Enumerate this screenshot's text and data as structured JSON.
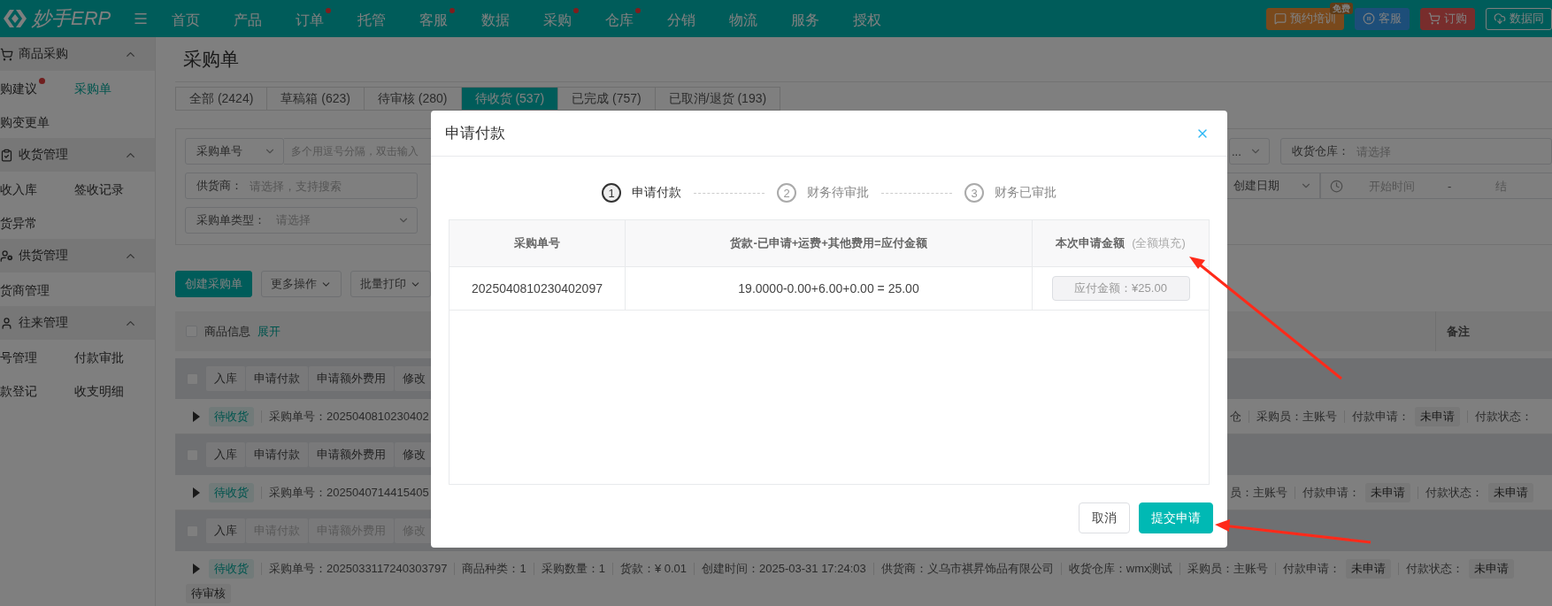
{
  "topbar": {
    "logo": "妙手ERP",
    "nav": [
      {
        "label": "首页",
        "dot": false
      },
      {
        "label": "产品",
        "dot": false
      },
      {
        "label": "订单",
        "dot": true
      },
      {
        "label": "托管",
        "dot": false
      },
      {
        "label": "客服",
        "dot": true
      },
      {
        "label": "数据",
        "dot": false
      },
      {
        "label": "采购",
        "dot": true
      },
      {
        "label": "仓库",
        "dot": true
      },
      {
        "label": "分销",
        "dot": false
      },
      {
        "label": "物流",
        "dot": false
      },
      {
        "label": "服务",
        "dot": false
      },
      {
        "label": "授权",
        "dot": false
      }
    ],
    "actions": [
      {
        "kind": "training",
        "label": "预约培训",
        "badge": "免费"
      },
      {
        "kind": "service",
        "label": "客服"
      },
      {
        "kind": "order",
        "label": "订购"
      },
      {
        "kind": "sync",
        "label": "数据同"
      }
    ]
  },
  "sidebar": [
    {
      "title": "商品采购",
      "expanded": true,
      "items": [
        {
          "label": "购建议",
          "dot": true,
          "selected": false
        },
        {
          "label": "采购单",
          "dot": false,
          "selected": true
        },
        {
          "label": "购变更单",
          "dot": false,
          "selected": false
        }
      ]
    },
    {
      "title": "收货管理",
      "expanded": true,
      "items": [
        {
          "label": "收入库",
          "dot": false,
          "selected": false
        },
        {
          "label": "签收记录",
          "dot": false,
          "selected": false
        },
        {
          "label": "货异常",
          "dot": false,
          "selected": false
        }
      ]
    },
    {
      "title": "供货管理",
      "expanded": true,
      "items": [
        {
          "label": "货商管理",
          "dot": false,
          "selected": false
        }
      ]
    },
    {
      "title": "往来管理",
      "expanded": true,
      "items": [
        {
          "label": "号管理",
          "dot": false,
          "selected": false
        },
        {
          "label": "付款审批",
          "dot": false,
          "selected": false
        },
        {
          "label": "款登记",
          "dot": false,
          "selected": false
        },
        {
          "label": "收支明细",
          "dot": false,
          "selected": false
        }
      ]
    }
  ],
  "page": {
    "title": "采购单",
    "tabs": [
      {
        "label": "全部 (2424)",
        "selected": false
      },
      {
        "label": "草稿箱 (623)",
        "selected": false
      },
      {
        "label": "待审核 (280)",
        "selected": false
      },
      {
        "label": "待收货 (537)",
        "selected": true
      },
      {
        "label": "已完成 (757)",
        "selected": false
      },
      {
        "label": "已取消/退货 (193)",
        "selected": false
      }
    ],
    "filters": {
      "order_field": {
        "label": "采购单号",
        "placeholder": "多个用逗号分隔，双击输入"
      },
      "right_select": {
        "value": "..."
      },
      "warehouse": {
        "label": "收货仓库：",
        "placeholder": "请选择"
      },
      "supplier": {
        "label": "供货商：",
        "placeholder": "请选择，支持搜索"
      },
      "date": {
        "type": "创建日期",
        "start_placeholder": "开始时间",
        "separator": "-",
        "end_placeholder": "结"
      },
      "order_type": {
        "label": "采购单类型：",
        "placeholder": "请选择"
      }
    },
    "toolbar": [
      {
        "kind": "primary",
        "label": "创建采购单"
      },
      {
        "kind": "dropdown",
        "label": "更多操作"
      },
      {
        "kind": "dropdown",
        "label": "批量打印"
      }
    ],
    "table": {
      "select_all": false,
      "label": "商品信息",
      "expand_link": "展开",
      "remark": "备注"
    },
    "orders": [
      {
        "checked": false,
        "actions": [
          {
            "label": "入库",
            "disabled": false
          },
          {
            "label": "申请付款",
            "disabled": false
          },
          {
            "label": "申请额外费用",
            "disabled": false
          },
          {
            "label": "修改",
            "disabled": false
          }
        ],
        "status": "待收货",
        "left": [
          {
            "kind": "text",
            "text": "采购单号：2025040810230402"
          }
        ],
        "right": [
          {
            "kind": "text",
            "text": "仓"
          },
          {
            "kind": "text",
            "text": "采购员：主账号"
          },
          {
            "kind": "text",
            "text": "付款申请："
          },
          {
            "kind": "tag",
            "text": "未申请"
          },
          {
            "kind": "text",
            "text": "付款状态："
          }
        ]
      },
      {
        "checked": false,
        "actions": [
          {
            "label": "入库",
            "disabled": false
          },
          {
            "label": "申请付款",
            "disabled": false
          },
          {
            "label": "申请额外费用",
            "disabled": false
          },
          {
            "label": "修改",
            "disabled": false
          }
        ],
        "status": "待收货",
        "left": [
          {
            "kind": "text",
            "text": "采购单号：2025040714415405"
          }
        ],
        "right": [
          {
            "kind": "text",
            "text": "员：主账号"
          },
          {
            "kind": "text",
            "text": "付款申请："
          },
          {
            "kind": "tag",
            "text": "未申请"
          },
          {
            "kind": "text",
            "text": "付款状态："
          },
          {
            "kind": "tag",
            "text": "未申请"
          }
        ]
      },
      {
        "checked": false,
        "actions": [
          {
            "label": "入库",
            "disabled": false
          },
          {
            "label": "申请付款",
            "disabled": true
          },
          {
            "label": "申请额外费用",
            "disabled": true
          },
          {
            "label": "修改",
            "disabled": true
          }
        ],
        "status": "待收货",
        "left": [
          {
            "kind": "text",
            "text": "采购单号：2025033117240303797"
          },
          {
            "kind": "text",
            "text": "商品种类：1"
          },
          {
            "kind": "text",
            "text": "采购数量：1"
          },
          {
            "kind": "text",
            "text": "货款：¥ 0.01"
          },
          {
            "kind": "text",
            "text": "创建时间：2025-03-31 17:24:03"
          },
          {
            "kind": "text",
            "text": "供货商：义乌市祺昇饰品有限公司"
          },
          {
            "kind": "text",
            "text": "收货仓库：wmx测试"
          },
          {
            "kind": "text",
            "text": "采购员：主账号"
          },
          {
            "kind": "text",
            "text": "付款申请："
          },
          {
            "kind": "tag",
            "text": "未申请"
          },
          {
            "kind": "text",
            "text": "付款状态："
          },
          {
            "kind": "tag",
            "text": "未申请"
          }
        ],
        "sub_tag": "待审核"
      }
    ]
  },
  "dialog": {
    "title": "申请付款",
    "steps": [
      {
        "number": "1",
        "label": "申请付款",
        "active": true
      },
      {
        "number": "2",
        "label": "财务待审批",
        "active": false
      },
      {
        "number": "3",
        "label": "财务已审批",
        "active": false
      }
    ],
    "table": {
      "columns": [
        {
          "label": "采购单号"
        },
        {
          "label": "货款-已申请+运费+其他费用=应付金额"
        },
        {
          "label": "本次申请金额",
          "hint": "(全额填充)"
        }
      ],
      "rows": [
        {
          "order_no": "2025040810230402097",
          "formula": "19.0000-0.00+6.00+0.00 = 25.00",
          "amount": {
            "value": "应付金额：¥25.00",
            "disabled": true
          }
        }
      ]
    },
    "buttons": [
      {
        "kind": "secondary",
        "label": "取消"
      },
      {
        "kind": "primary",
        "label": "提交申请"
      }
    ]
  }
}
